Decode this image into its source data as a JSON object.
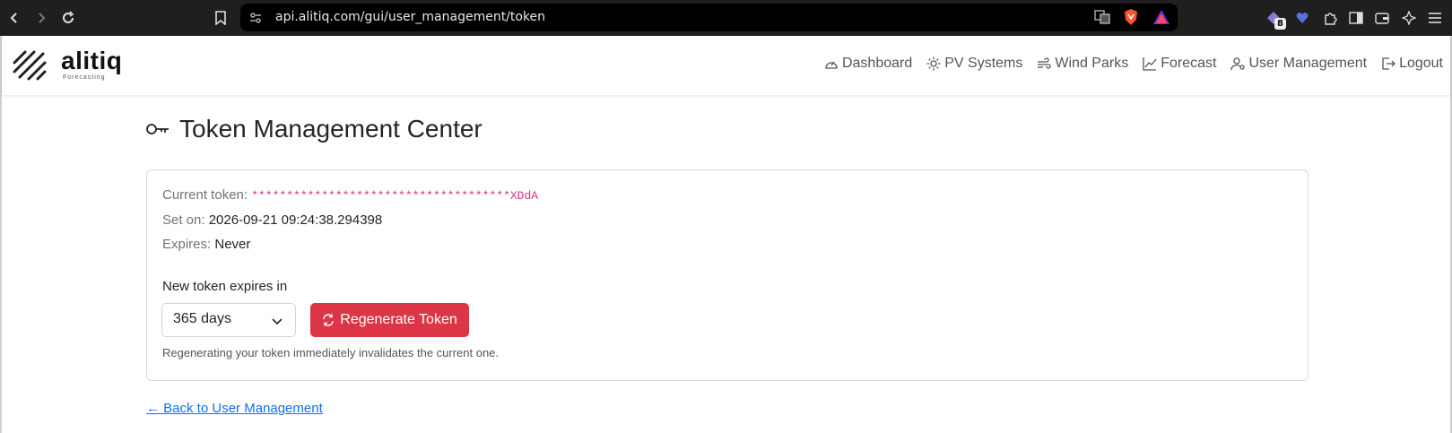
{
  "browser": {
    "url": "api.alitiq.com/gui/user_management/token",
    "extension_badge": "8"
  },
  "brand": {
    "name": "alitiq",
    "tagline": "Forecasting"
  },
  "nav": {
    "items": [
      {
        "label": "Dashboard",
        "icon": "speedometer-icon"
      },
      {
        "label": "PV Systems",
        "icon": "sun-icon"
      },
      {
        "label": "Wind Parks",
        "icon": "wind-icon"
      },
      {
        "label": "Forecast",
        "icon": "chart-line-icon"
      },
      {
        "label": "User Management",
        "icon": "users-icon"
      },
      {
        "label": "Logout",
        "icon": "logout-icon"
      }
    ]
  },
  "main": {
    "title": "Token Management Center",
    "current_token_label": "Current token:",
    "current_token_value": "*************************************XDdA",
    "set_on_label": "Set on:",
    "set_on_value": "2026-09-21 09:24:38.294398",
    "expires_label": "Expires:",
    "expires_value": "Never",
    "new_token_label": "New token expires in",
    "expiry_selected": "365 days",
    "regenerate_label": "Regenerate Token",
    "hint": "Regenerating your token immediately invalidates the current one.",
    "back_link": "← Back to User Management"
  },
  "colors": {
    "danger": "#dc3545",
    "link": "#0d6efd",
    "token": "#d63384"
  }
}
